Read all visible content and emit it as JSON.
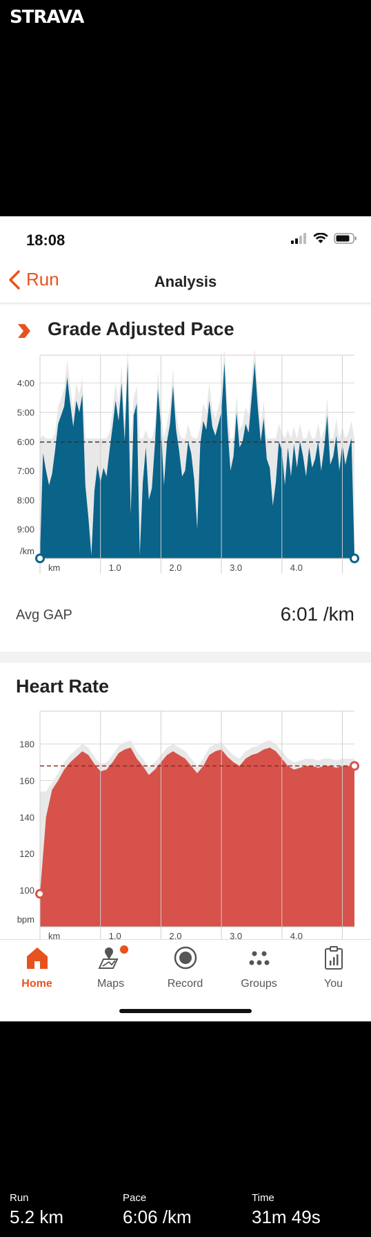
{
  "brand": "STRAVA",
  "status_bar": {
    "time": "18:08"
  },
  "nav": {
    "back_label": "Run",
    "title": "Analysis"
  },
  "gap_section": {
    "title": "Grade Adjusted Pace",
    "avg_label": "Avg GAP",
    "avg_value": "6:01 /km"
  },
  "hr_section": {
    "title": "Heart Rate"
  },
  "tabs": [
    {
      "label": "Home",
      "icon": "home-icon",
      "active": true
    },
    {
      "label": "Maps",
      "icon": "maps-icon",
      "active": false
    },
    {
      "label": "Record",
      "icon": "record-icon",
      "active": false
    },
    {
      "label": "Groups",
      "icon": "groups-icon",
      "active": false
    },
    {
      "label": "You",
      "icon": "you-icon",
      "active": false
    }
  ],
  "summary": {
    "run_label": "Run",
    "run_value": "5.2 km",
    "pace_label": "Pace",
    "pace_value": "6:06 /km",
    "time_label": "Time",
    "time_value": "31m 49s"
  },
  "colors": {
    "accent": "#e8521e",
    "pace_fill": "#0a6389",
    "hr_fill": "#d6524a",
    "elevation": "#e6e6e6"
  },
  "chart_data": [
    {
      "type": "area",
      "title": "Grade Adjusted Pace",
      "ylabel": "/km",
      "xlabel": "km",
      "x_tick_labels": [
        "km",
        "1.0",
        "2.0",
        "3.0",
        "4.0"
      ],
      "x_ticks": [
        0,
        1,
        2,
        3,
        4
      ],
      "y_tick_labels": [
        "4:00",
        "5:00",
        "6:00",
        "7:00",
        "8:00",
        "9:00"
      ],
      "y_ticks": [
        4,
        5,
        6,
        7,
        8,
        9
      ],
      "ylim": [
        3.05,
        10
      ],
      "xlim": [
        0,
        5.2
      ],
      "y_inverted": true,
      "average": 6.02,
      "x": [
        0,
        0.05,
        0.1,
        0.15,
        0.2,
        0.25,
        0.3,
        0.35,
        0.4,
        0.45,
        0.5,
        0.55,
        0.6,
        0.65,
        0.7,
        0.75,
        0.8,
        0.85,
        0.9,
        0.95,
        1.0,
        1.05,
        1.1,
        1.15,
        1.2,
        1.25,
        1.3,
        1.35,
        1.4,
        1.45,
        1.5,
        1.55,
        1.6,
        1.65,
        1.7,
        1.75,
        1.8,
        1.85,
        1.9,
        1.95,
        2.0,
        2.05,
        2.1,
        2.15,
        2.2,
        2.25,
        2.3,
        2.35,
        2.4,
        2.45,
        2.5,
        2.55,
        2.6,
        2.65,
        2.7,
        2.75,
        2.8,
        2.85,
        2.9,
        2.95,
        3.0,
        3.05,
        3.1,
        3.15,
        3.2,
        3.25,
        3.3,
        3.35,
        3.4,
        3.45,
        3.5,
        3.55,
        3.6,
        3.65,
        3.7,
        3.75,
        3.8,
        3.85,
        3.9,
        3.95,
        4.0,
        4.05,
        4.1,
        4.15,
        4.2,
        4.25,
        4.3,
        4.35,
        4.4,
        4.45,
        4.5,
        4.55,
        4.6,
        4.65,
        4.7,
        4.75,
        4.8,
        4.85,
        4.9,
        4.95,
        5.0,
        5.05,
        5.1,
        5.15,
        5.2
      ],
      "y": [
        9.9,
        6.4,
        7.0,
        7.5,
        7.1,
        6.3,
        5.4,
        5.1,
        4.8,
        3.8,
        4.7,
        5.5,
        4.6,
        5.0,
        4.4,
        7.5,
        8.6,
        9.9,
        7.7,
        6.8,
        7.4,
        6.9,
        7.2,
        6.3,
        5.5,
        4.6,
        5.3,
        4.0,
        6.0,
        3.3,
        8.5,
        5.1,
        4.7,
        9.9,
        7.4,
        6.2,
        8.0,
        7.6,
        6.1,
        4.2,
        5.5,
        7.5,
        6.0,
        5.4,
        4.1,
        5.6,
        6.3,
        7.2,
        7.0,
        6.0,
        6.4,
        7.3,
        9.0,
        6.1,
        5.3,
        5.6,
        4.6,
        5.5,
        5.8,
        5.4,
        5.0,
        3.3,
        5.5,
        7.0,
        6.5,
        5.0,
        6.2,
        6.0,
        5.4,
        5.7,
        4.5,
        3.3,
        4.8,
        6.0,
        5.2,
        6.6,
        6.9,
        8.2,
        7.4,
        6.0,
        6.3,
        7.5,
        6.2,
        7.2,
        6.1,
        6.9,
        6.0,
        6.5,
        7.2,
        6.2,
        6.9,
        6.6,
        6.0,
        7.0,
        6.2,
        5.1,
        6.8,
        6.5,
        5.8,
        7.0,
        6.1,
        6.8,
        6.3,
        5.9,
        9.9
      ]
    },
    {
      "type": "area",
      "title": "Heart Rate",
      "ylabel": "bpm",
      "xlabel": "km",
      "x_tick_labels": [
        "km",
        "1.0",
        "2.0",
        "3.0",
        "4.0"
      ],
      "x_ticks": [
        0,
        1,
        2,
        3,
        4
      ],
      "y_tick_labels": [
        "100",
        "120",
        "140",
        "160",
        "180"
      ],
      "y_ticks": [
        100,
        120,
        140,
        160,
        180
      ],
      "ylim": [
        80,
        198
      ],
      "xlim": [
        0,
        5.2
      ],
      "average": 168,
      "start_value": 98,
      "end_value": 168,
      "x": [
        0,
        0.1,
        0.2,
        0.3,
        0.4,
        0.5,
        0.6,
        0.7,
        0.8,
        0.9,
        1.0,
        1.1,
        1.2,
        1.3,
        1.4,
        1.5,
        1.6,
        1.7,
        1.8,
        1.9,
        2.0,
        2.1,
        2.2,
        2.3,
        2.4,
        2.5,
        2.6,
        2.7,
        2.8,
        2.9,
        3.0,
        3.1,
        3.2,
        3.3,
        3.4,
        3.5,
        3.6,
        3.7,
        3.8,
        3.9,
        4.0,
        4.1,
        4.2,
        4.3,
        4.4,
        4.5,
        4.6,
        4.7,
        4.8,
        4.9,
        5.0,
        5.1,
        5.2
      ],
      "y": [
        98,
        140,
        155,
        160,
        166,
        170,
        173,
        176,
        174,
        169,
        165,
        166,
        170,
        175,
        177,
        178,
        172,
        168,
        163,
        166,
        170,
        174,
        176,
        174,
        172,
        168,
        164,
        168,
        174,
        176,
        177,
        173,
        170,
        168,
        172,
        174,
        175,
        177,
        178,
        176,
        172,
        168,
        166,
        167,
        168,
        168,
        167,
        168,
        168,
        167,
        168,
        168,
        168
      ]
    }
  ]
}
